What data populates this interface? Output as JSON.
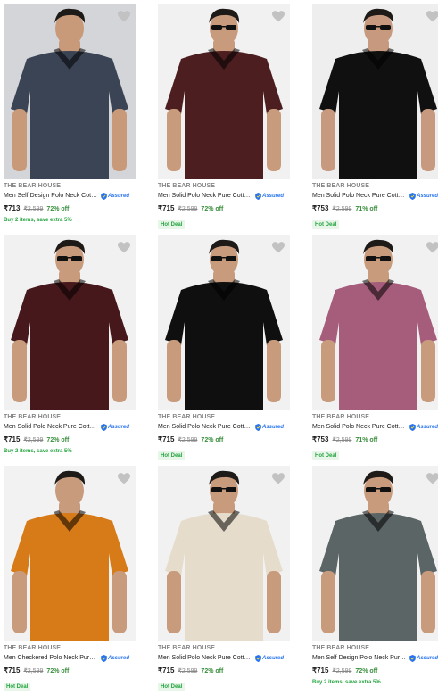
{
  "colors": {
    "accent_blue": "#2874f0",
    "discount_green": "#388e3c",
    "offer_green": "#26a541",
    "wishlist_grey": "#c2c2c2"
  },
  "icons": {
    "wishlist": "heart-icon",
    "assured": "assured-shield-icon"
  },
  "products": [
    {
      "brand": "THE BEAR HOUSE",
      "title": "Men Self Design Polo Neck Cotto...",
      "assured": "Assured",
      "price": "₹713",
      "mrp": "₹2,599",
      "discount": "72% off",
      "offer": "Buy 2 items, save extra 5%",
      "badge": "",
      "shirt_color": "#3a4454",
      "bg": "#d4d5d9",
      "skin": "#c99a7a",
      "sunglasses": false
    },
    {
      "brand": "THE BEAR HOUSE",
      "title": "Men Solid Polo Neck Pure Cotto...",
      "assured": "Assured",
      "price": "₹715",
      "mrp": "₹2,599",
      "discount": "72% off",
      "offer": "",
      "badge": "Hot Deal",
      "shirt_color": "#4d1e20",
      "bg": "#f1f1f2",
      "skin": "#c99b7d",
      "sunglasses": true
    },
    {
      "brand": "THE BEAR HOUSE",
      "title": "Men Solid Polo Neck Pure Cotto...",
      "assured": "Assured",
      "price": "₹753",
      "mrp": "₹2,599",
      "discount": "71% off",
      "offer": "",
      "badge": "Hot Deal",
      "shirt_color": "#101010",
      "bg": "#eeeeef",
      "skin": "#c79a80",
      "sunglasses": true
    },
    {
      "brand": "THE BEAR HOUSE",
      "title": "Men Solid Polo Neck Pure Cotto...",
      "assured": "Assured",
      "price": "₹715",
      "mrp": "₹2,599",
      "discount": "72% off",
      "offer": "Buy 2 items, save extra 5%",
      "badge": "",
      "shirt_color": "#47181b",
      "bg": "#f1f1f2",
      "skin": "#c99b7d",
      "sunglasses": true
    },
    {
      "brand": "THE BEAR HOUSE",
      "title": "Men Solid Polo Neck Pure Cotto...",
      "assured": "Assured",
      "price": "₹715",
      "mrp": "₹2,599",
      "discount": "72% off",
      "offer": "",
      "badge": "Hot Deal",
      "shirt_color": "#0f0f0f",
      "bg": "#f1f1f2",
      "skin": "#c99b7d",
      "sunglasses": true
    },
    {
      "brand": "THE BEAR HOUSE",
      "title": "Men Solid Polo Neck Pure Cotto...",
      "assured": "Assured",
      "price": "₹753",
      "mrp": "₹2,599",
      "discount": "71% off",
      "offer": "",
      "badge": "Hot Deal",
      "shirt_color": "#a65d7c",
      "bg": "#f1f1f2",
      "skin": "#c99b7d",
      "sunglasses": true
    },
    {
      "brand": "THE BEAR HOUSE",
      "title": "Men Checkered Polo Neck Pure ...",
      "assured": "Assured",
      "price": "₹715",
      "mrp": "₹2,599",
      "discount": "72% off",
      "offer": "",
      "badge": "Hot Deal",
      "shirt_color": "#d77a18",
      "bg": "#f2f2f3",
      "skin": "#c99b7d",
      "sunglasses": false
    },
    {
      "brand": "THE BEAR HOUSE",
      "title": "Men Solid Polo Neck Pure Cotto...",
      "assured": "Assured",
      "price": "₹715",
      "mrp": "₹2,599",
      "discount": "72% off",
      "offer": "",
      "badge": "Hot Deal",
      "shirt_color": "#e6dccb",
      "bg": "#f1f1f2",
      "skin": "#c99b7d",
      "sunglasses": true
    },
    {
      "brand": "THE BEAR HOUSE",
      "title": "Men Self Design Polo Neck Pure...",
      "assured": "Assured",
      "price": "₹715",
      "mrp": "₹2,599",
      "discount": "72% off",
      "offer": "Buy 2 items, save extra 5%",
      "badge": "",
      "shirt_color": "#5b6566",
      "bg": "#f1f1f2",
      "skin": "#c99b7d",
      "sunglasses": true
    }
  ]
}
